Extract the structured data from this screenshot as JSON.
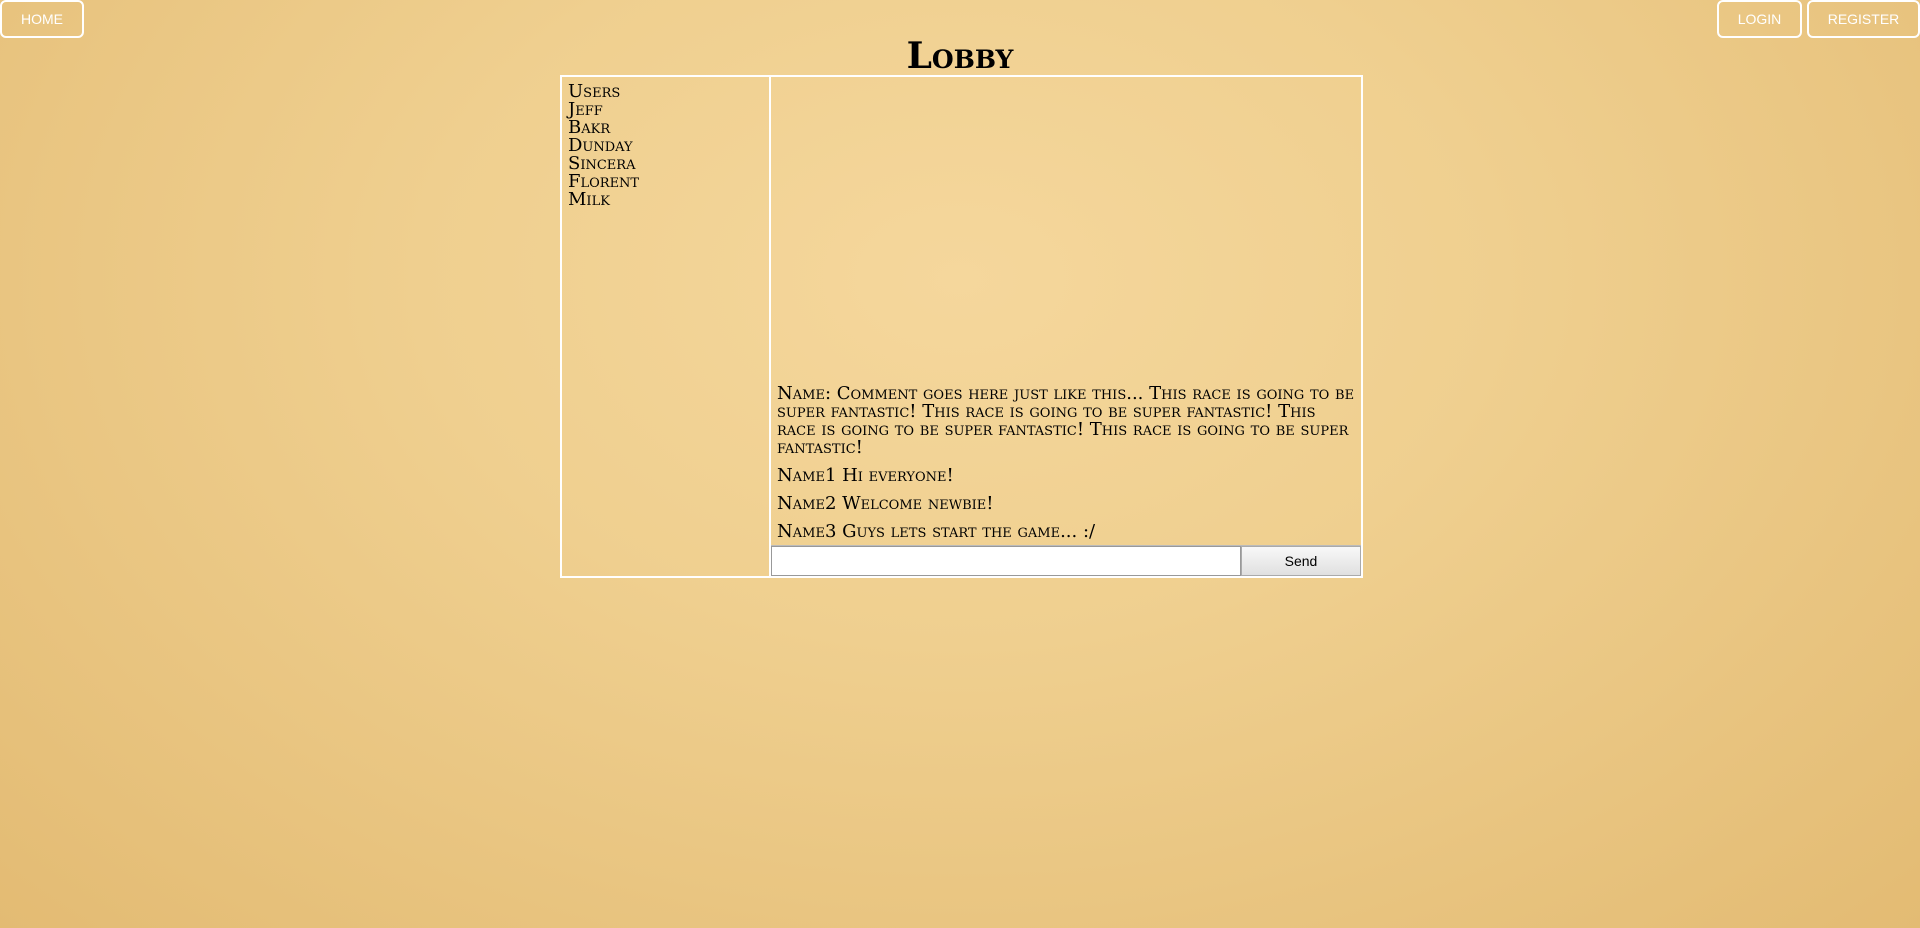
{
  "nav": {
    "home_label": "HOME",
    "login_label": "LOGIN",
    "register_label": "REGISTER"
  },
  "page": {
    "title": "Lobby"
  },
  "users": {
    "header": "Users",
    "items": [
      "Jeff",
      "Bakr",
      "Dunday",
      "Sincera",
      "Florent",
      "Milk"
    ]
  },
  "chat": {
    "messages": [
      "Name: Comment goes here just like this... This race is going to be super fantastic! This race is going to be super fantastic! This race is going to be super fantastic! This race is going to be super fantastic!",
      "Name1 Hi everyone!",
      "Name2 Welcome newbie!",
      "Name3 Guys lets start the game... :/"
    ],
    "input_value": "",
    "send_label": "Send"
  },
  "colors": {
    "background_center": "#f5d79c",
    "background_edge": "#e3bb73",
    "border": "#ffffff"
  }
}
